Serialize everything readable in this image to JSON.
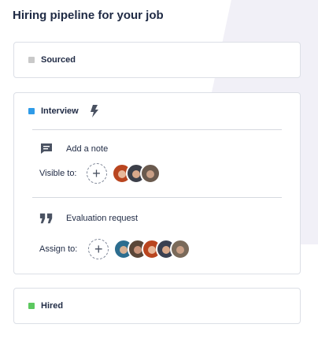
{
  "page": {
    "title": "Hiring pipeline for your job"
  },
  "stages": {
    "sourced": {
      "name": "Sourced",
      "color": "#c9c9c9"
    },
    "interview": {
      "name": "Interview",
      "color": "#2f9be8",
      "icon": "lightning-bolt-icon",
      "actions": {
        "note": {
          "icon": "comment-icon",
          "label": "Add a note",
          "people_label": "Visible to:",
          "add_icon": "plus-icon",
          "avatars": [
            "#b9451f",
            "#3c3f49",
            "#6a5a4e"
          ]
        },
        "evaluation": {
          "icon": "quote-icon",
          "label": "Evaluation request",
          "people_label": "Assign to:",
          "add_icon": "plus-icon",
          "avatars": [
            "#2c6d8f",
            "#5a4638",
            "#b9451f",
            "#3a4051",
            "#7a6a5a"
          ]
        }
      }
    },
    "hired": {
      "name": "Hired",
      "color": "#5cc85f"
    }
  },
  "colors": {
    "text": "#1f2a44",
    "border": "#dcdfe6",
    "bg_shape": "#f1f0f7"
  }
}
